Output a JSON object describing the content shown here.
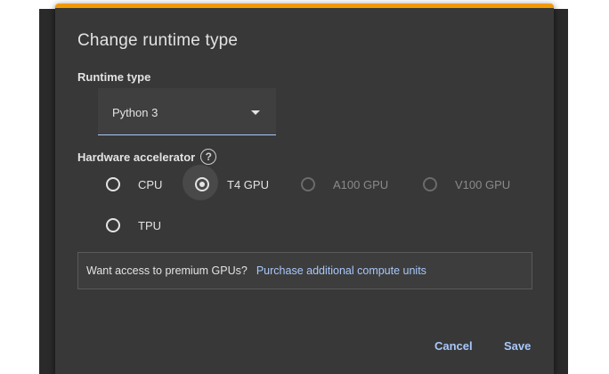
{
  "dialog": {
    "title": "Change runtime type",
    "accent_color": "#f29900"
  },
  "runtime": {
    "label": "Runtime type",
    "selected": "Python 3",
    "arrow_icon": "dropdown-arrow-icon"
  },
  "hardware": {
    "label": "Hardware accelerator",
    "help_icon": "help-icon",
    "help_glyph": "?",
    "options": [
      {
        "label": "CPU",
        "selected": false,
        "disabled": false
      },
      {
        "label": "T4 GPU",
        "selected": true,
        "disabled": false
      },
      {
        "label": "A100 GPU",
        "selected": false,
        "disabled": true
      },
      {
        "label": "V100 GPU",
        "selected": false,
        "disabled": true
      },
      {
        "label": "TPU",
        "selected": false,
        "disabled": false
      }
    ]
  },
  "notice": {
    "text": "Want access to premium GPUs?",
    "link": "Purchase additional compute units"
  },
  "buttons": {
    "cancel": "Cancel",
    "save": "Save"
  }
}
